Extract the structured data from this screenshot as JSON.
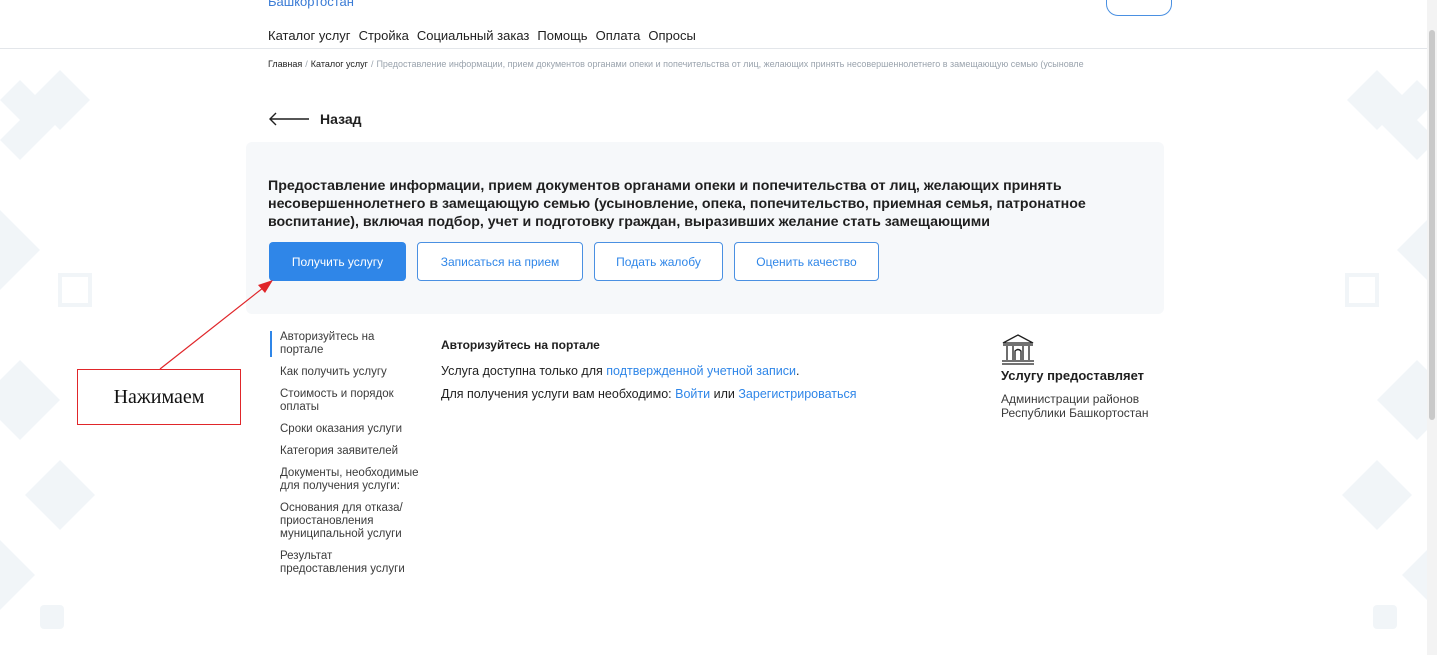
{
  "header": {
    "partial_region": "Башкортостан",
    "nav": [
      "Каталог услуг",
      "Стройка",
      "Социальный заказ",
      "Помощь",
      "Оплата",
      "Опросы"
    ]
  },
  "breadcrumb": {
    "home": "Главная",
    "catalog": "Каталог услуг",
    "separator": "/",
    "current": "Предоставление информации, прием документов органами опеки и попечительства от лиц, желающих принять несовершеннолетнего в замещающую семью (усыновле"
  },
  "back": {
    "label": "Назад"
  },
  "service": {
    "title": "Предоставление информации, прием документов органами опеки и попечительства от лиц, желающих принять несовершеннолетнего в замещающую семью (усыновление, опека, попечительство, приемная семья, патронатное воспитание), включая подбор, учет и подготовку граждан, выразивших желание стать замещающими"
  },
  "actions": {
    "get_service": "Получить услугу",
    "book": "Записаться на прием",
    "complain": "Подать жалобу",
    "rate": "Оценить качество"
  },
  "side_menu": [
    "Авторизуйтесь на портале",
    "Как получить услугу",
    "Стоимость и порядок оплаты",
    "Сроки оказания услуги",
    "Категория заявителей",
    "Документы, необходимые для получения услуги:",
    "Основания для отказа/приостановления муниципальной услуги",
    "Результат предоставления услуги"
  ],
  "main": {
    "heading": "Авторизуйтесь на портале",
    "line1_prefix": "Услуга доступна только для",
    "line1_link": "подтвержденной учетной записи",
    "line1_suffix": ".",
    "line2_prefix": "Для получения услуги вам необходимо:",
    "login_link": "Войти",
    "or": "или",
    "register_link": "Зарегистрироваться"
  },
  "provider": {
    "title": "Услугу предоставляет",
    "name": "Администрации районов Республики Башкортостан"
  },
  "annotation": {
    "text": "Нажимаем"
  },
  "colors": {
    "accent": "#2f86e8",
    "annotation": "#e0262a",
    "card_bg": "#f6f8fa"
  }
}
